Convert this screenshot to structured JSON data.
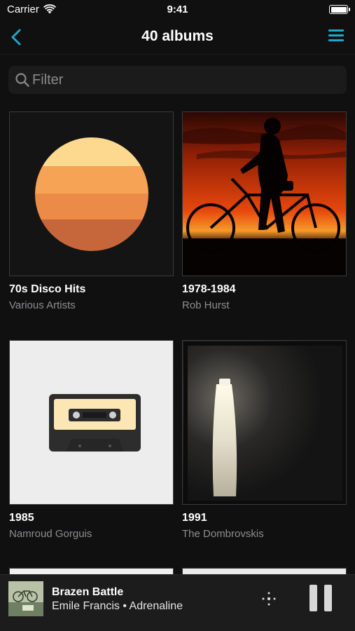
{
  "status_bar": {
    "carrier": "Carrier",
    "time": "9:41"
  },
  "nav": {
    "title": "40 albums",
    "accent_color": "#1fa6c8"
  },
  "filter": {
    "placeholder": "Filter"
  },
  "albums": [
    {
      "title": "70s Disco Hits",
      "artist": "Various Artists"
    },
    {
      "title": "1978-1984",
      "artist": "Rob Hurst"
    },
    {
      "title": "1985",
      "artist": "Namroud Gorguis"
    },
    {
      "title": "1991",
      "artist": "The Dombrovskis"
    }
  ],
  "now_playing": {
    "title": "Brazen Battle",
    "subtitle": "Emile Francis • Adrenaline"
  },
  "icons": [
    "wifi-icon",
    "battery-icon",
    "back-chevron-icon",
    "menu-icon",
    "search-icon",
    "audio-output-icon",
    "pause-icon"
  ]
}
